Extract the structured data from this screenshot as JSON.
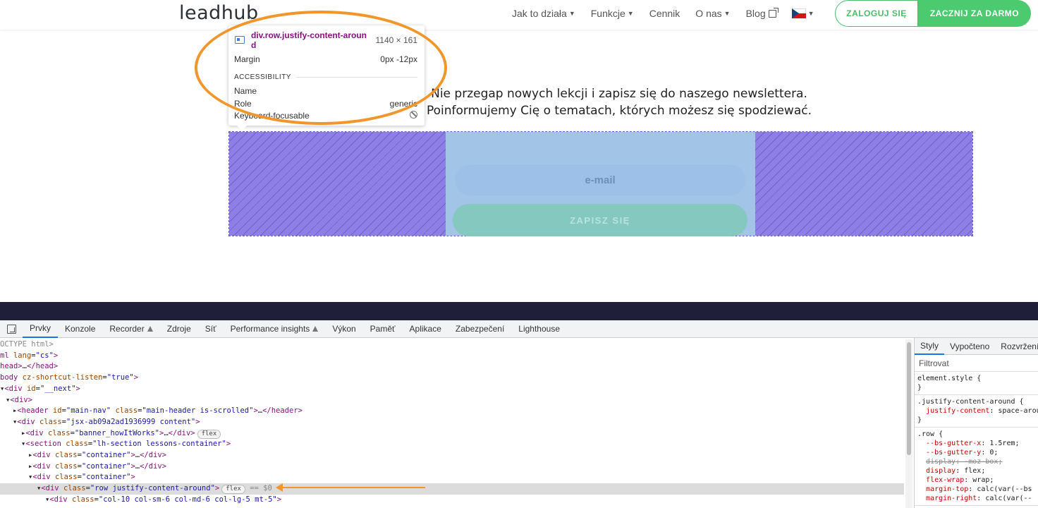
{
  "site": {
    "logo": "leadhub",
    "nav": [
      {
        "label": "Jak to działa",
        "caret": true
      },
      {
        "label": "Funkcje",
        "caret": true
      },
      {
        "label": "Cennik",
        "caret": false
      },
      {
        "label": "O nas",
        "caret": true
      },
      {
        "label": "Blog",
        "caret": false
      }
    ],
    "login_label": "ZALOGUJ SIĘ",
    "start_label": "ZACZNIJ ZA DARMO"
  },
  "newsletter": {
    "line1": "Nie przegap nowych lekcji i zapisz się do naszego newslettera.",
    "line2": "Poinformujemy Cię o tematach, których możesz się spodziewać.",
    "email_placeholder": "e-mail",
    "subscribe_label": "ZAPISZ SIĘ"
  },
  "tooltip": {
    "selector": "div.row.justify-content-around",
    "size": "1140 × 161",
    "margin_label": "Margin",
    "margin_value": "0px -12px",
    "accessibility_heading": "ACCESSIBILITY",
    "name_label": "Name",
    "role_label": "Role",
    "role_value": "generic",
    "keyboard_label": "Keyboard-focusable"
  },
  "devtools": {
    "tabs": [
      "Prvky",
      "Konzole",
      "Recorder",
      "Zdroje",
      "Síť",
      "Performance insights",
      "Výkon",
      "Paměť",
      "Aplikace",
      "Zabezpečení",
      "Lighthouse"
    ],
    "active_tab": "Prvky",
    "styles_tabs": [
      "Styly",
      "Vypočteno",
      "Rozvržení"
    ],
    "filter_label": "Filtrovat",
    "flex_badge": "flex",
    "dollar_ref": "== $0"
  },
  "colors": {
    "brand_green": "#4cca6f",
    "highlight_padding": "#8e7fe6",
    "highlight_content": "#a2c4e6",
    "annotation_orange": "#f0962b"
  }
}
